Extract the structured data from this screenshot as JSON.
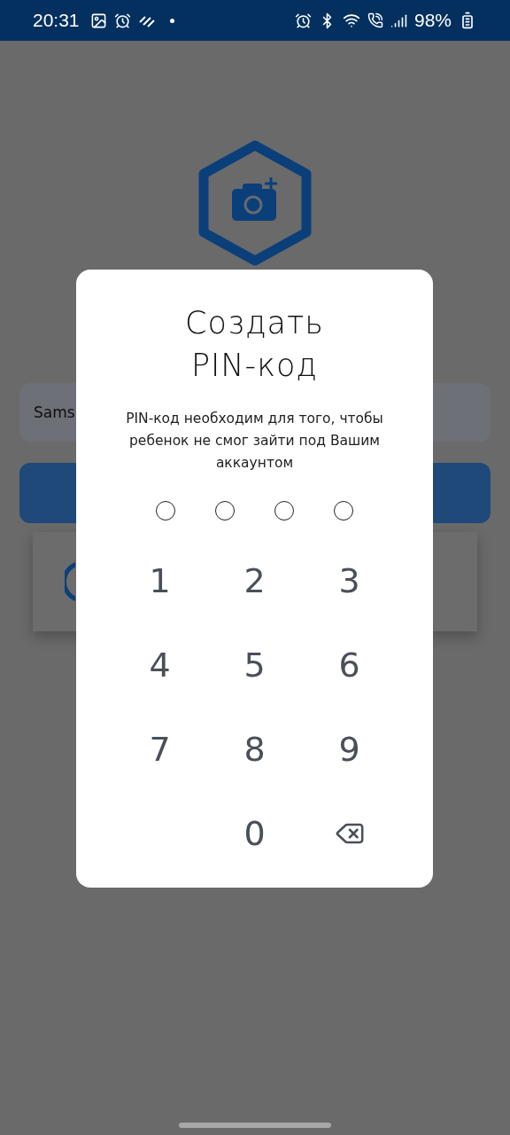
{
  "status_bar": {
    "time": "20:31",
    "battery": "98%"
  },
  "background": {
    "field_value": "Sams"
  },
  "dialog": {
    "title": "Создать\nPIN-код",
    "description": "PIN-код необходим для того, чтобы ребенок не смог зайти под Вашим аккаунтом",
    "pin_dots": [
      {
        "filled": false
      },
      {
        "filled": false
      },
      {
        "filled": false
      },
      {
        "filled": false
      }
    ],
    "keys": [
      {
        "kind": "digit",
        "label": "1"
      },
      {
        "kind": "digit",
        "label": "2"
      },
      {
        "kind": "digit",
        "label": "3"
      },
      {
        "kind": "digit",
        "label": "4"
      },
      {
        "kind": "digit",
        "label": "5"
      },
      {
        "kind": "digit",
        "label": "6"
      },
      {
        "kind": "digit",
        "label": "7"
      },
      {
        "kind": "digit",
        "label": "8"
      },
      {
        "kind": "digit",
        "label": "9"
      },
      {
        "kind": "empty"
      },
      {
        "kind": "digit",
        "label": "0"
      },
      {
        "kind": "backspace"
      }
    ]
  }
}
